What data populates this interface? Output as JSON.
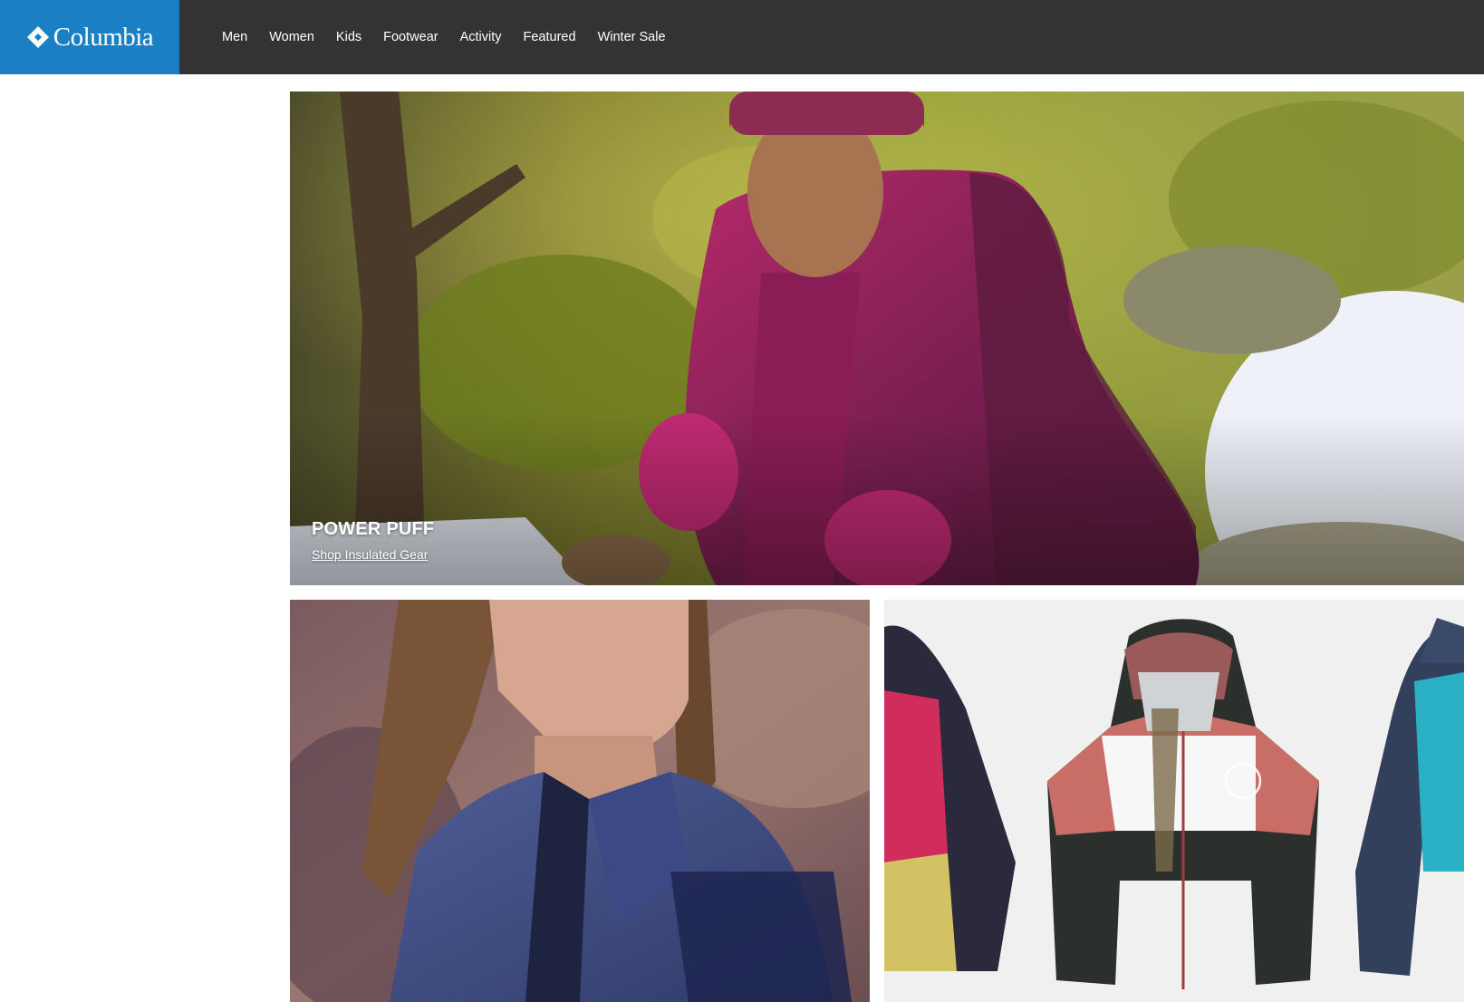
{
  "brand": {
    "name": "Columbia",
    "logo_icon": "columbia-diamond-icon",
    "color": "#1a80c3"
  },
  "header": {
    "background": "#333333"
  },
  "nav": {
    "items": [
      {
        "label": "Men"
      },
      {
        "label": "Women"
      },
      {
        "label": "Kids"
      },
      {
        "label": "Footwear"
      },
      {
        "label": "Activity"
      },
      {
        "label": "Featured"
      },
      {
        "label": "Winter Sale"
      }
    ]
  },
  "hero": {
    "title": "POWER PUFF",
    "link": "Shop Insulated Gear"
  }
}
